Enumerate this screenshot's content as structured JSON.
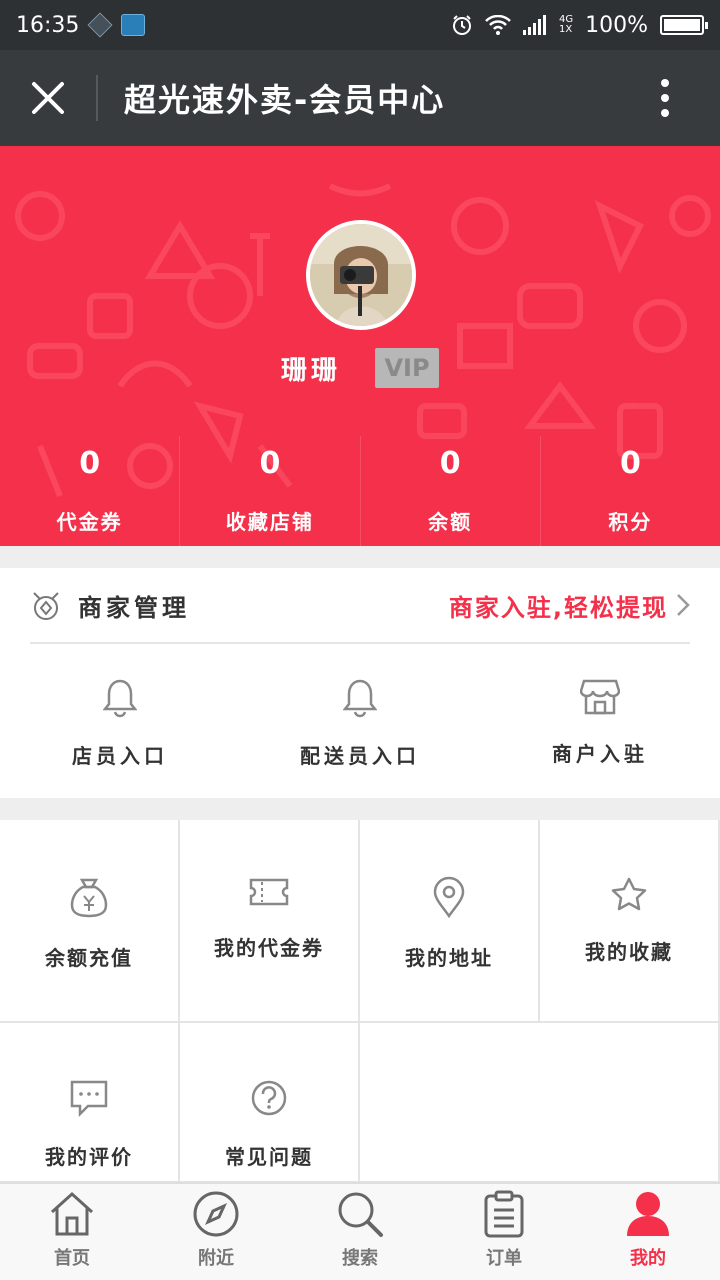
{
  "status_bar": {
    "time": "16:35",
    "battery": "100%",
    "network": "4G",
    "network_sub": "1X"
  },
  "title_bar": {
    "title": "超光速外卖-会员中心"
  },
  "profile": {
    "username": "珊珊",
    "vip_label": "VIP",
    "stats": [
      {
        "value": "0",
        "label": "代金券"
      },
      {
        "value": "0",
        "label": "收藏店铺"
      },
      {
        "value": "0",
        "label": "余额"
      },
      {
        "value": "0",
        "label": "积分"
      }
    ]
  },
  "merchant": {
    "title": "商家管理",
    "link": "商家入驻,轻松提现",
    "items": [
      {
        "label": "店员入口",
        "icon": "bell-icon"
      },
      {
        "label": "配送员入口",
        "icon": "bell-icon"
      },
      {
        "label": "商户入驻",
        "icon": "store-icon"
      }
    ]
  },
  "grid": [
    {
      "label": "余额充值",
      "icon": "money-bag-icon"
    },
    {
      "label": "我的代金券",
      "icon": "ticket-icon"
    },
    {
      "label": "我的地址",
      "icon": "location-pin-icon"
    },
    {
      "label": "我的收藏",
      "icon": "star-icon"
    },
    {
      "label": "我的评价",
      "icon": "comment-icon"
    },
    {
      "label": "常见问题",
      "icon": "question-icon"
    }
  ],
  "bottom_nav": [
    {
      "label": "首页",
      "icon": "home-icon"
    },
    {
      "label": "附近",
      "icon": "compass-icon"
    },
    {
      "label": "搜索",
      "icon": "search-icon"
    },
    {
      "label": "订单",
      "icon": "clipboard-icon"
    },
    {
      "label": "我的",
      "icon": "user-icon",
      "active": true
    }
  ],
  "colors": {
    "accent": "#f4304a",
    "titlebar": "#383b3e",
    "statusbar": "#2e3133"
  }
}
